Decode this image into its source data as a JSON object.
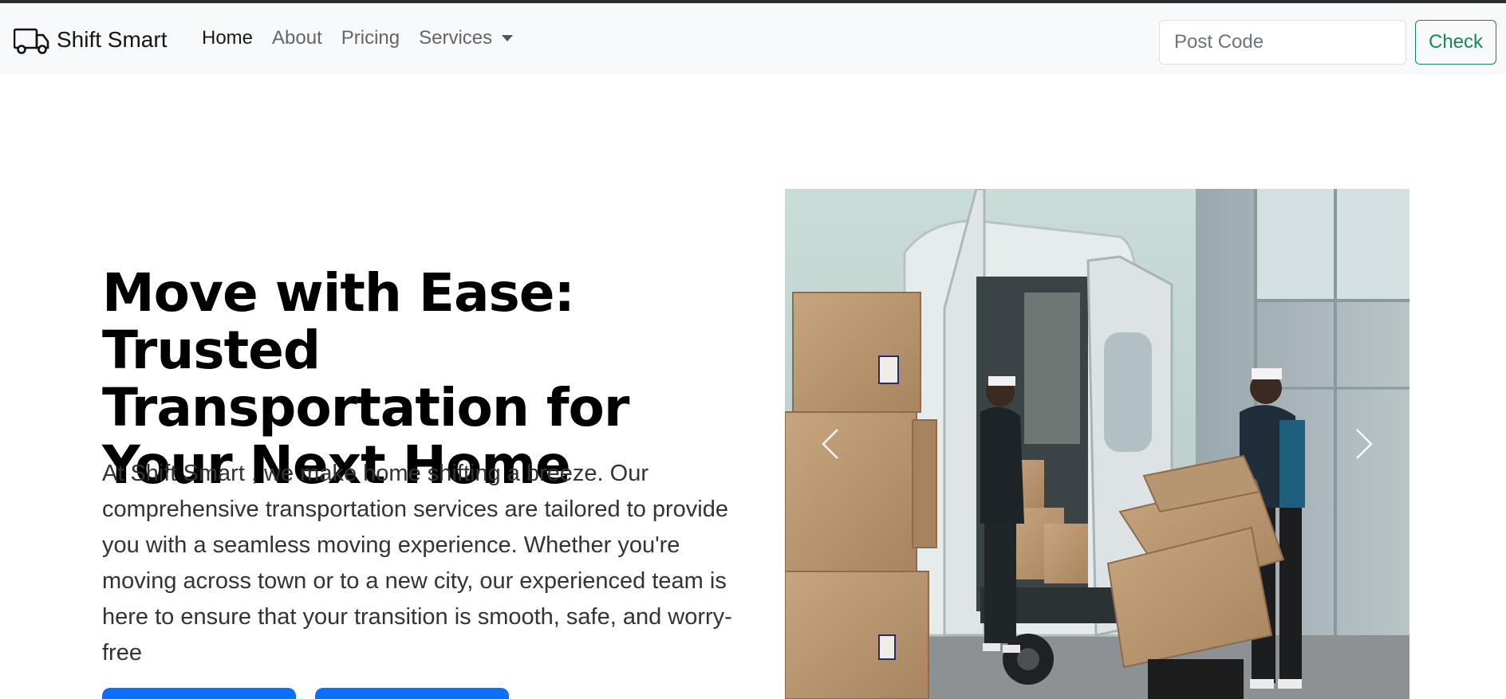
{
  "brand": {
    "name": "Shift Smart",
    "logo_icon": "truck-icon"
  },
  "nav": {
    "links": [
      {
        "label": "Home",
        "active": true
      },
      {
        "label": "About",
        "active": false
      },
      {
        "label": "Pricing",
        "active": false
      }
    ],
    "services_label": "Services"
  },
  "search": {
    "placeholder": "Post Code",
    "value": "",
    "button_label": "Check"
  },
  "hero": {
    "title": "Move with Ease: Trusted Transportation for Your Next Home",
    "lead": "At Shift Smart , we make home shifting a breeze. Our comprehensive transportation services are tailored to provide you with a seamless moving experience. Whether you're moving across town or to a new city, our experienced team is here to ensure that your transition is smooth, safe, and worry-free",
    "buttons": [
      "",
      ""
    ]
  },
  "carousel": {
    "image_alt": "Two movers loading cardboard boxes into a white van",
    "prev_icon": "chevron-left-icon",
    "next_icon": "chevron-right-icon"
  },
  "colors": {
    "navbar_bg": "#f8f9fa",
    "primary": "#0d6efd",
    "success": "#198754",
    "title": "#000000"
  }
}
